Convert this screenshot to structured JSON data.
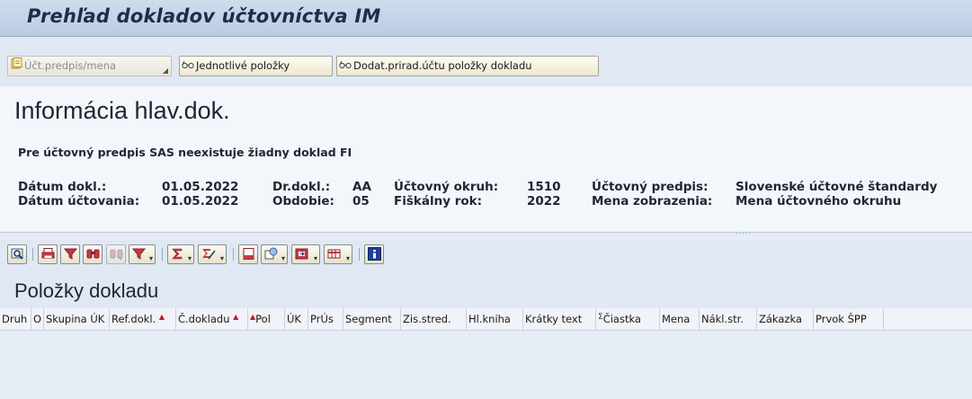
{
  "window": {
    "title": "Prehľad dokladov účtovníctva IM"
  },
  "app_toolbar": {
    "buttons": [
      {
        "label": "Účt.predpis/mena",
        "icon": "ledger-icon",
        "disabled": true,
        "has_dropdown": true
      },
      {
        "label": "Jednotlivé položky",
        "icon": "glasses-icon",
        "disabled": false,
        "has_dropdown": false
      },
      {
        "label": "Dodat.prirad.účtu položky dokladu",
        "icon": "glasses-icon",
        "disabled": false,
        "has_dropdown": false
      }
    ]
  },
  "header": {
    "title": "Informácia hlav.dok.",
    "message": "Pre účtovný predpis SAS neexistuje žiadny doklad FI",
    "fields": {
      "doc_date_label": "Dátum dokl.:",
      "doc_date": "01.05.2022",
      "posting_date_label": "Dátum účtovania:",
      "posting_date": "01.05.2022",
      "doc_type_label": "Dr.dokl.:",
      "doc_type": "AA",
      "period_label": "Obdobie:",
      "period": "05",
      "company_code_label": "Účtovný okruh:",
      "company_code": "1510",
      "fiscal_year_label": "Fiškálny rok:",
      "fiscal_year": "2022",
      "ledger_label": "Účtovný predpis:",
      "ledger": "Slovenské účtovné štandardy",
      "currency_label": "Mena zobrazenia:",
      "currency": "Mena účtovného okruhu"
    }
  },
  "grid": {
    "title": "Položky dokladu",
    "columns": [
      {
        "label": "Druh"
      },
      {
        "label": "O"
      },
      {
        "label": "Skupina ÚK"
      },
      {
        "label": "Ref.dokl.",
        "sort": "▲"
      },
      {
        "label": "Č.dokladu",
        "sort": "▲"
      },
      {
        "label": "Pol",
        "sort_prefix": "▲"
      },
      {
        "label": "ÚK"
      },
      {
        "label": "PrÚs"
      },
      {
        "label": "Segment"
      },
      {
        "label": "Zis.stred."
      },
      {
        "label": "Hl.kniha"
      },
      {
        "label": "Krátky text"
      },
      {
        "label": "Čiastka",
        "prefix": "Σ"
      },
      {
        "label": "Mena"
      },
      {
        "label": "Nákl.str."
      },
      {
        "label": "Zákazka"
      },
      {
        "label": "Prvok ŠPP"
      }
    ]
  },
  "grid_toolbar_icons": [
    "details-icon",
    "print-icon",
    "filter-icon",
    "find-icon",
    "find-next-icon",
    "filter-dropdown-icon",
    "sum-icon",
    "subtotal-icon",
    "print-preview-icon",
    "export-icon",
    "spreadsheet-icon",
    "layout-icon",
    "info-icon"
  ]
}
